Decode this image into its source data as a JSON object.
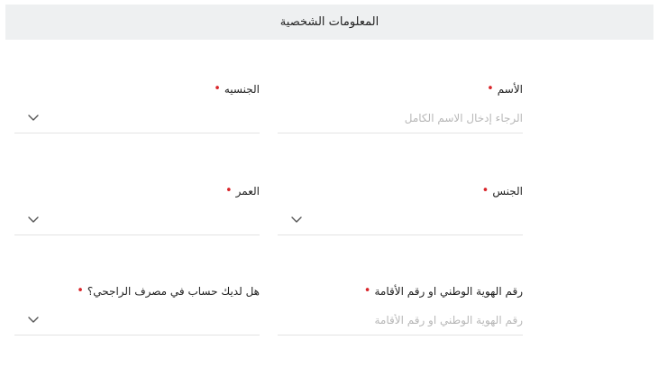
{
  "section": {
    "title": "المعلومات الشخصية"
  },
  "fields": {
    "name": {
      "label": "الأسم",
      "required_mark": "•",
      "placeholder": "الرجاء إدخال الاسم الكامل",
      "value": ""
    },
    "nationality": {
      "label": "الجنسيه",
      "required_mark": "•",
      "selected": "",
      "icon": "chevron-down-icon"
    },
    "gender": {
      "label": "الجنس",
      "required_mark": "•",
      "selected": "",
      "icon": "chevron-down-icon"
    },
    "age": {
      "label": "العمر",
      "required_mark": "•",
      "selected": "",
      "icon": "chevron-down-icon"
    },
    "id_number": {
      "label": "رقم الهوية الوطني او رقم الأقامة",
      "required_mark": "•",
      "placeholder": "رقم الهوية الوطني او رقم الأقامة",
      "value": ""
    },
    "has_account": {
      "label": "هل لديك حساب في مصرف الراجحي؟",
      "required_mark": "•",
      "selected": "",
      "icon": "chevron-down-icon"
    }
  },
  "colors": {
    "required": "#d9252a",
    "header_bg": "#eef0f1",
    "placeholder": "#b8b8b8",
    "underline": "#e3e3e3"
  }
}
